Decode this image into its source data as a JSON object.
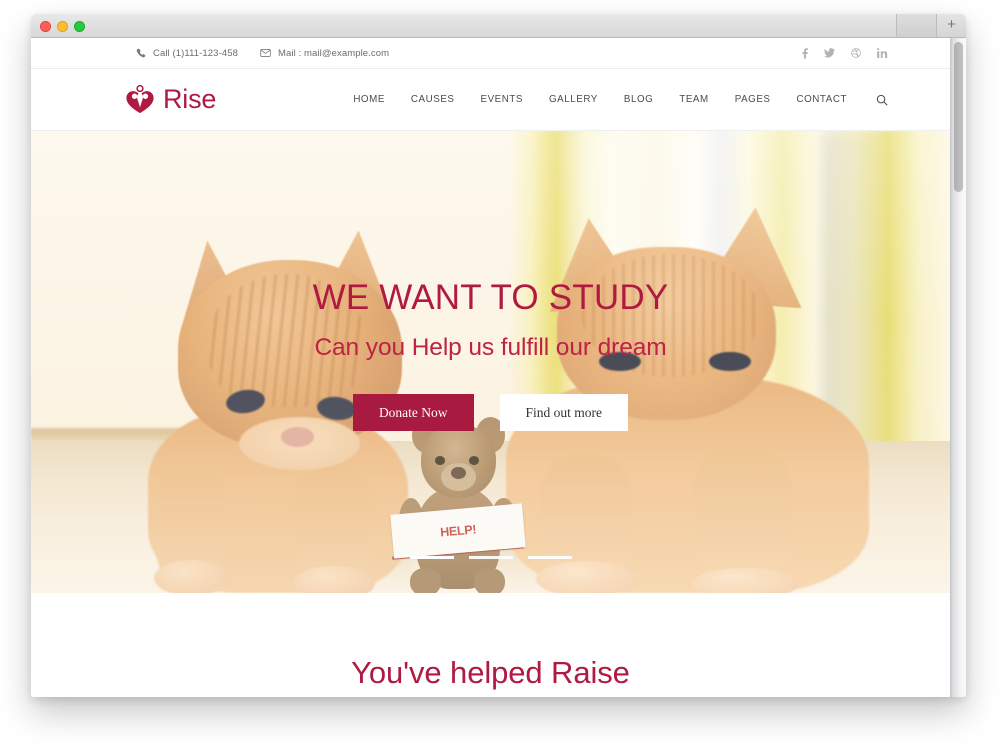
{
  "browser": {
    "new_tab_label": "+",
    "window_controls": [
      "close",
      "minimize",
      "maximize"
    ]
  },
  "topbar": {
    "phone": "Call (1)111-123-458",
    "email": "Mail : mail@example.com",
    "social": [
      {
        "name": "facebook",
        "glyph": "f"
      },
      {
        "name": "twitter",
        "glyph": "t"
      },
      {
        "name": "dribbble",
        "glyph": "d"
      },
      {
        "name": "linkedin",
        "glyph": "in"
      }
    ]
  },
  "header": {
    "brand_name": "Rise",
    "nav": [
      {
        "label": "HOME"
      },
      {
        "label": "CAUSES"
      },
      {
        "label": "EVENTS"
      },
      {
        "label": "GALLERY"
      },
      {
        "label": "BLOG"
      },
      {
        "label": "TEAM"
      },
      {
        "label": "PAGES"
      },
      {
        "label": "CONTACT"
      }
    ],
    "search_icon": "search-icon"
  },
  "hero": {
    "title": "WE WANT TO STUDY",
    "subtitle": "Can you Help us fulfill our dream",
    "primary_button": "Donate Now",
    "secondary_button": "Find out more",
    "sign_text": "HELP!",
    "slides": 3,
    "active_slide": 1
  },
  "section": {
    "raise_title": "You've helped Raise"
  },
  "colors": {
    "brand_crimson": "#b01a41",
    "button_crimson": "#a81a3f",
    "text_gray": "#4c4c4c",
    "muted_gray": "#6d6d6d"
  }
}
